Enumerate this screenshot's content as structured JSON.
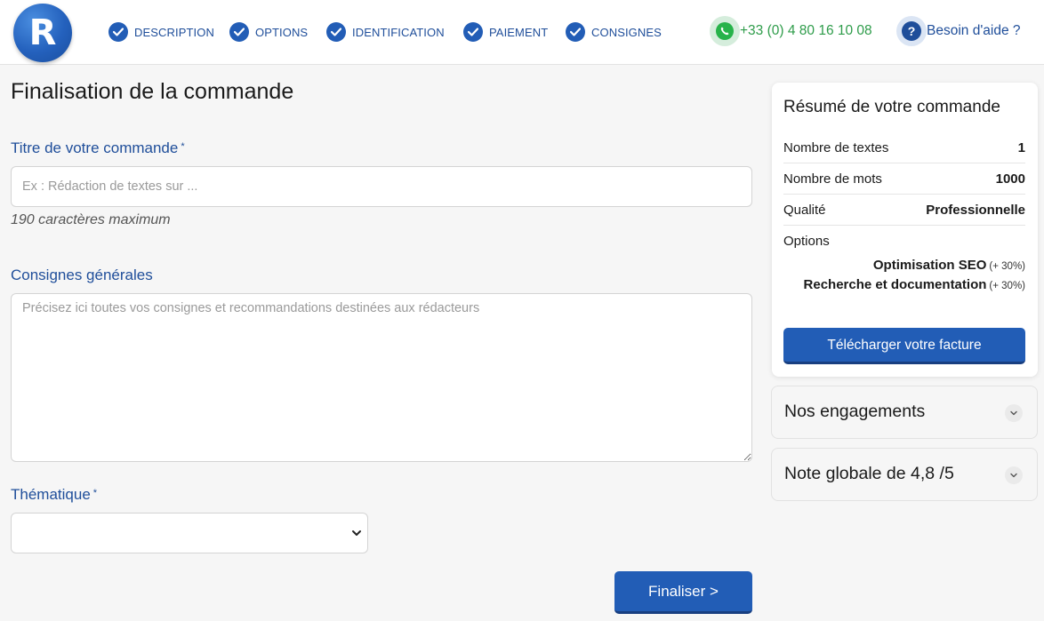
{
  "brand": {
    "logo_letter": "R"
  },
  "steps": [
    {
      "label": "DESCRIPTION"
    },
    {
      "label": "OPTIONS"
    },
    {
      "label": "IDENTIFICATION"
    },
    {
      "label": "PAIEMENT"
    },
    {
      "label": "CONSIGNES"
    }
  ],
  "contact": {
    "phone": "+33 (0) 4 80 16 10 08",
    "phone_icon": "whatsapp-icon",
    "help_label": "Besoin d'aide ?",
    "help_icon": "question-icon"
  },
  "colors": {
    "primary": "#225db6",
    "link": "#1f4e9a",
    "phone": "#2e9c4a"
  },
  "form": {
    "page_title": "Finalisation de la commande",
    "title_label": "Titre de votre commande",
    "required_mark": "*",
    "title_placeholder": "Ex : Rédaction de textes sur ...",
    "title_hint": "190 caractères maximum",
    "instructions_label": "Consignes générales",
    "instructions_placeholder": "Précisez ici toutes vos consignes et recommandations destinées aux rédacteurs",
    "theme_label": "Thématique",
    "theme_value": "",
    "finalize_label": "Finaliser >"
  },
  "summary": {
    "title": "Résumé de votre commande",
    "rows": [
      {
        "key": "Nombre de textes",
        "value": "1"
      },
      {
        "key": "Nombre de mots",
        "value": "1000"
      },
      {
        "key": "Qualité",
        "value": "Professionnelle"
      }
    ],
    "options_label": "Options",
    "options": [
      {
        "name": "Optimisation SEO",
        "extra": "(+ 30%)"
      },
      {
        "name": "Recherche et documentation",
        "extra": "(+ 30%)"
      }
    ],
    "invoice_label": "Télécharger votre facture"
  },
  "accordions": [
    {
      "title": "Nos engagements"
    },
    {
      "title": "Note globale de 4,8 /5"
    }
  ]
}
